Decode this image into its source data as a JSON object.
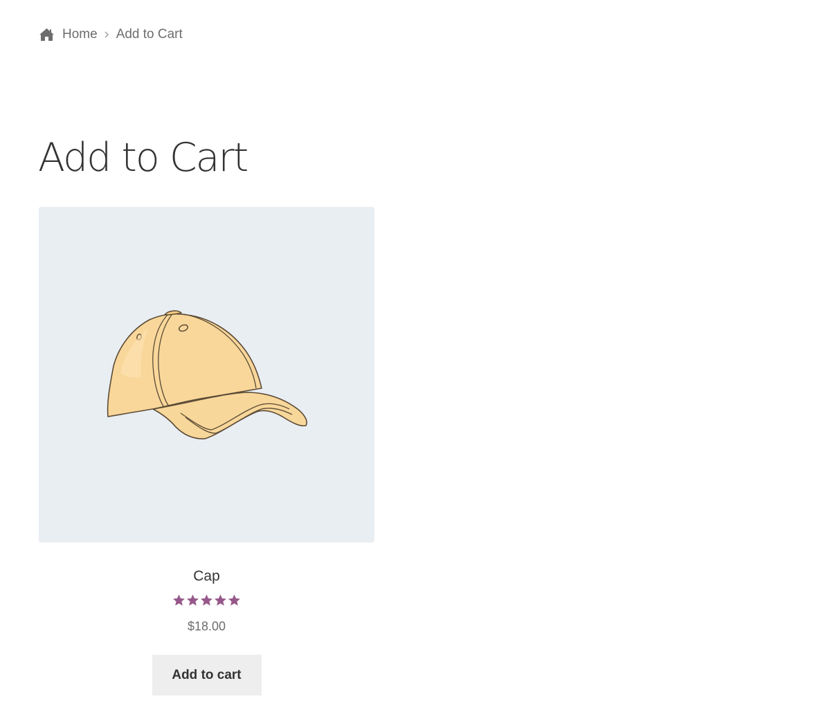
{
  "breadcrumb": {
    "home_label": "Home",
    "current_label": "Add to Cart",
    "home_icon": "home-icon",
    "separator_icon": "chevron-right-icon"
  },
  "page": {
    "title": "Add to Cart"
  },
  "product": {
    "name": "Cap",
    "rating": 5,
    "rating_max": 5,
    "price": "$18.00",
    "add_to_cart_label": "Add to cart",
    "image_icon": "cap-image"
  },
  "colors": {
    "rating_star": "#96588a",
    "image_background": "#e9eef3",
    "button_background": "#eeeeee",
    "text_muted": "#6d6d6d",
    "text_dark": "#333333"
  }
}
